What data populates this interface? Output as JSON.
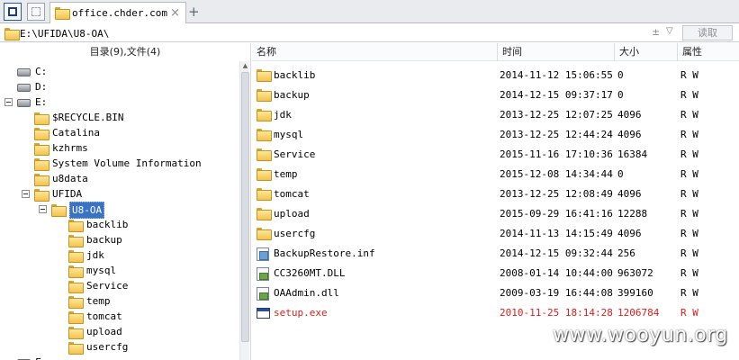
{
  "tab": {
    "title": "office.chder.com",
    "close": "×",
    "add": "+"
  },
  "address": {
    "path": "E:\\UFIDA\\U8-OA\\",
    "plus": "±",
    "caret": "▽",
    "read_button": "读取"
  },
  "tree": {
    "header": "目录(9),文件(4)",
    "drives": [
      {
        "label": "C:"
      },
      {
        "label": "D:"
      },
      {
        "label": "E:",
        "toggle": "−"
      }
    ],
    "e_children": [
      {
        "label": "$RECYCLE.BIN"
      },
      {
        "label": "Catalina"
      },
      {
        "label": "kzhrms"
      },
      {
        "label": "System Volume Information"
      },
      {
        "label": "u8data"
      },
      {
        "label": "UFIDA",
        "toggle": "−"
      }
    ],
    "selected": {
      "label": "U8-OA",
      "toggle": "−"
    },
    "oa_children": [
      {
        "label": "backlib"
      },
      {
        "label": "backup"
      },
      {
        "label": "jdk"
      },
      {
        "label": "mysql"
      },
      {
        "label": "Service"
      },
      {
        "label": "temp"
      },
      {
        "label": "tomcat"
      },
      {
        "label": "upload"
      },
      {
        "label": "usercfg"
      }
    ],
    "partial_last": "F:"
  },
  "columns": {
    "name": "名称",
    "time": "时间",
    "size": "大小",
    "attr": "属性"
  },
  "files": [
    {
      "name": "backlib",
      "time": "2014-11-12 15:06:55",
      "size": "0",
      "attr": "R W",
      "icon": "folder-icon"
    },
    {
      "name": "backup",
      "time": "2014-12-15 09:37:17",
      "size": "0",
      "attr": "R W",
      "icon": "folder-icon"
    },
    {
      "name": "jdk",
      "time": "2013-12-25 12:07:25",
      "size": "4096",
      "attr": "R W",
      "icon": "folder-icon"
    },
    {
      "name": "mysql",
      "time": "2013-12-25 12:44:24",
      "size": "4096",
      "attr": "R W",
      "icon": "folder-icon"
    },
    {
      "name": "Service",
      "time": "2015-11-16 17:10:36",
      "size": "16384",
      "attr": "R W",
      "icon": "folder-icon"
    },
    {
      "name": "temp",
      "time": "2015-12-08 14:34:44",
      "size": "0",
      "attr": "R W",
      "icon": "folder-icon"
    },
    {
      "name": "tomcat",
      "time": "2013-12-25 12:08:49",
      "size": "4096",
      "attr": "R W",
      "icon": "folder-icon"
    },
    {
      "name": "upload",
      "time": "2015-09-29 16:41:16",
      "size": "12288",
      "attr": "R W",
      "icon": "folder-icon"
    },
    {
      "name": "usercfg",
      "time": "2014-11-13 14:15:49",
      "size": "4096",
      "attr": "R W",
      "icon": "folder-icon"
    },
    {
      "name": "BackupRestore.inf",
      "time": "2014-12-15 09:32:44",
      "size": "256",
      "attr": "R W",
      "icon": "inf-file-icon"
    },
    {
      "name": "CC3260MT.DLL",
      "time": "2008-01-14 10:44:00",
      "size": "963072",
      "attr": "R W",
      "icon": "dll-file-icon"
    },
    {
      "name": "OAAdmin.dll",
      "time": "2009-03-19 16:44:08",
      "size": "399160",
      "attr": "R W",
      "icon": "dll-file-icon"
    },
    {
      "name": "setup.exe",
      "time": "2010-11-25 18:14:28",
      "size": "1206784",
      "attr": "R W",
      "icon": "exe-file-icon"
    }
  ],
  "colors": {
    "highlight": "#e31b1b",
    "selection": "#3a72c4",
    "folder": "#f3c24c"
  },
  "watermark": "www.wooyun.org"
}
